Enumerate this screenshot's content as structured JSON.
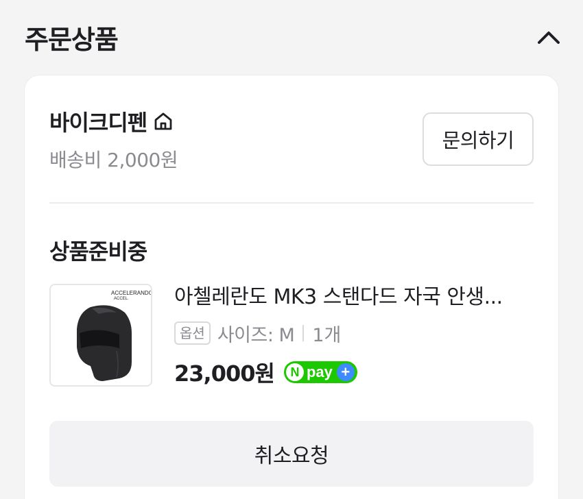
{
  "section": {
    "title": "주문상품",
    "collapse_icon": "chevron-up-icon"
  },
  "store": {
    "name": "바이크디펜",
    "home_icon": "home-icon",
    "shipping": "배송비 2,000원",
    "inquiry_label": "문의하기"
  },
  "order": {
    "status": "상품준비중",
    "product": {
      "name": "아첼레란도 MK3 스탠다드 자국 안생...",
      "option_badge": "옵션",
      "option": "사이즈: M",
      "quantity": "1개",
      "price": "23,000원",
      "thumbnail_brand": "ACCELERANDO",
      "thumbnail_brand_sub": "ACCEL."
    },
    "npay": {
      "n": "N",
      "text": "pay",
      "plus": "+"
    }
  },
  "actions": {
    "cancel_label": "취소요청"
  },
  "colors": {
    "background": "#f4f4f5",
    "card": "#ffffff",
    "npay_green": "#1ec800",
    "npay_blue": "#3d8bff"
  }
}
